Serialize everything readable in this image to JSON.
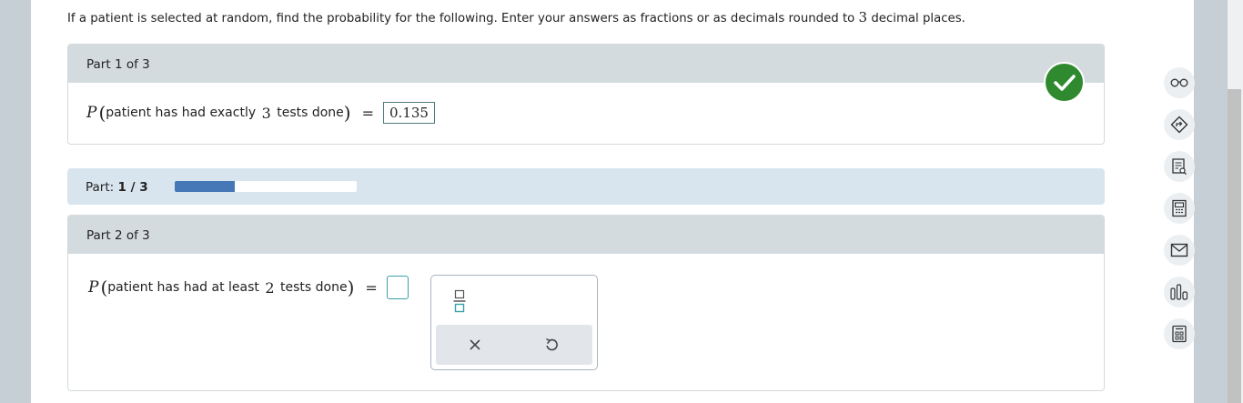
{
  "instructions": {
    "text_before": "If a patient is selected at random, find the probability for the following. Enter your answers as fractions or as decimals rounded to ",
    "digits": "3",
    "text_after": " decimal places."
  },
  "part1": {
    "header": "Part 1 of 3",
    "prob_symbol": "P",
    "open_paren": "(",
    "text_a": "patient has had exactly ",
    "number": "3",
    "text_b": " tests done",
    "close_paren": ")",
    "equals": "=",
    "answer": "0.135",
    "status": "correct"
  },
  "progress": {
    "label": "Part: ",
    "current": "1 / 3",
    "fraction_complete": 0.33
  },
  "part2": {
    "header": "Part 2 of 3",
    "prob_symbol": "P",
    "open_paren": "(",
    "text_a": "patient has had at least ",
    "number": "2",
    "text_b": " tests done",
    "close_paren": ")",
    "equals": "=",
    "answer": ""
  },
  "math_toolbar": {
    "buttons": [
      "fraction-template",
      "clear",
      "undo"
    ]
  },
  "sidebar": {
    "icons": [
      "glasses-icon",
      "signpost-icon",
      "textbook-icon",
      "calculator-icon",
      "mail-icon",
      "bar-chart-icon",
      "data-icon"
    ]
  },
  "colors": {
    "correct": "#2f8a2f",
    "progress_fill": "#4677b6",
    "input_border": "#3aa0a8",
    "header_bg": "#d4dbdf"
  }
}
